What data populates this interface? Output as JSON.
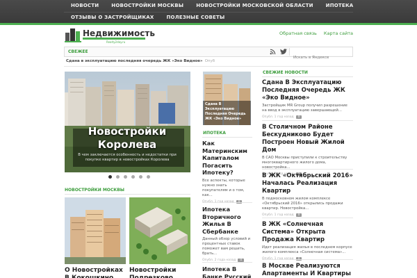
{
  "nav": {
    "row1": [
      "НОВОСТИ",
      "НОВОСТРОЙКИ МОСКВЫ",
      "НОВОСТРОЙКИ МОСКОВСКОЙ ОБЛАСТИ",
      "ИПОТЕКА"
    ],
    "row2": [
      "ОТЗЫВЫ О ЗАСТРОЙЩИКАХ",
      "ПОЛЕЗНЫЕ СОВЕТЫ"
    ]
  },
  "logo": {
    "name": "Недвижимость",
    "sub": "Realty2day.ru"
  },
  "header_links": [
    "Обратная связь",
    "Карта сайта"
  ],
  "fresh": {
    "label": "СВЕЖЕЕ",
    "search_placeholder": "Искать в Яндексе",
    "ticker_title": "Сдана в эксплуатацию последняя очередь ЖК «Эко Видное»",
    "ticker_date": "Опуб"
  },
  "slider": {
    "title": "Новостройки Королева",
    "text": "В чем заключается особенность и недостатки при покупке квартир в новостройках Королева",
    "active_slide": 1,
    "slide_count": 6
  },
  "moscow_section": {
    "label": "НОВОСТРОЙКИ МОСКВЫ",
    "cards": [
      {
        "title": "О Новостройках В Кокошкино"
      },
      {
        "title": "Новостройки Подрезково"
      }
    ]
  },
  "middle": {
    "featured_caption": "Сдана В Эксплуатацию Последняя Очередь ЖК «Эко Видное»",
    "section_label": "ИПОТЕКА",
    "items": [
      {
        "title": "Как Материнским Капиталом Погасить Ипотеку?",
        "text": "Все аспекты, которые нужно знать покупателям и о том, как...",
        "date": "Опубл. 1 год назад",
        "count": "0"
      },
      {
        "title": "Ипотека Вторичного Жилья В Сбербанке",
        "text": "Данный обзор условий и процентных ставок поможет вам решить, брать...",
        "date": "Опубл. 2 года назад",
        "count": "0"
      },
      {
        "title": "Ипотека В Банке Русский",
        "text": "",
        "date": "",
        "count": ""
      }
    ]
  },
  "right": {
    "section_label": "СВЕЖИЕ НОВОСТИ",
    "items": [
      {
        "title": "Сдана В Эксплуатацию Последняя Очередь ЖК «Эко Видное»",
        "text": "Застройщик MR Group получил разрешение на ввод в эксплуатацию завершающей...",
        "date": "Опубл. 1 год назад",
        "count": "0"
      },
      {
        "title": "В Столичном Районе Бескудниково Будет Построен Новый Жилой Дом",
        "text": "В САО Москвы приступили к строительству многоквартирного жилого дома, новостройка...",
        "date": "Опубл. 1 год назад",
        "count": "0"
      },
      {
        "title": "В ЖК «Октябрьский 2016» Началась Реализация Квартир",
        "text": "В подмосковном жилом комплексе «Октябрьский 2016» открылись продажи квартир. Новостройка...",
        "date": "Опубл. 1 год назад",
        "count": "0"
      },
      {
        "title": "В ЖК «Солнечная Система» Открыта Продажа Квартир",
        "text": "Идет реализация жилья в последнем корпусе жилого комплекса «Солнечная система»...",
        "date": "Опубл. 1 год назад",
        "count": "0"
      },
      {
        "title": "В Москве Реализуются Апартаменты И Квартиры",
        "text": "",
        "date": "",
        "count": ""
      }
    ]
  },
  "colors": {
    "accent": "#4caf50",
    "nav_bg": "#404040"
  }
}
